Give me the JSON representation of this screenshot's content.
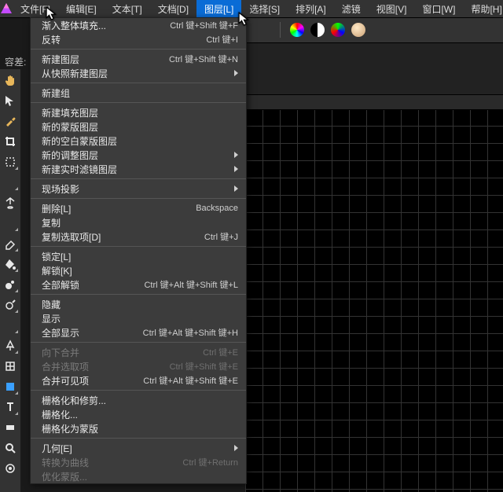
{
  "menubar": {
    "items": [
      {
        "label": "文件[F]"
      },
      {
        "label": "编辑[E]"
      },
      {
        "label": "文本[T]"
      },
      {
        "label": "文档[D]"
      },
      {
        "label": "图层[L]",
        "active": true
      },
      {
        "label": "选择[S]"
      },
      {
        "label": "排列[A]"
      },
      {
        "label": "滤镜"
      },
      {
        "label": "视图[V]"
      },
      {
        "label": "窗口[W]"
      },
      {
        "label": "帮助[H]"
      }
    ]
  },
  "left_label": "容差:",
  "dropdown": [
    {
      "type": "item",
      "label": "渐入整体填充...",
      "shortcut": "Ctrl 键+Shift 键+F"
    },
    {
      "type": "item",
      "label": "反转",
      "shortcut": "Ctrl 键+I"
    },
    {
      "type": "sep"
    },
    {
      "type": "item",
      "label": "新建图层",
      "shortcut": "Ctrl 键+Shift 键+N"
    },
    {
      "type": "item",
      "label": "从快照新建图层",
      "submenu": true
    },
    {
      "type": "sep"
    },
    {
      "type": "item",
      "label": "新建组"
    },
    {
      "type": "sep"
    },
    {
      "type": "item",
      "label": "新建填充图层"
    },
    {
      "type": "item",
      "label": "新的蒙版图层"
    },
    {
      "type": "item",
      "label": "新的空白蒙版图层"
    },
    {
      "type": "item",
      "label": "新的调整图层",
      "submenu": true
    },
    {
      "type": "item",
      "label": "新建实时滤镜图层",
      "submenu": true
    },
    {
      "type": "sep"
    },
    {
      "type": "item",
      "label": "现场投影",
      "submenu": true
    },
    {
      "type": "sep"
    },
    {
      "type": "item",
      "label": "删除[L]",
      "shortcut": "Backspace"
    },
    {
      "type": "item",
      "label": "复制"
    },
    {
      "type": "item",
      "label": "复制选取项[D]",
      "shortcut": "Ctrl 键+J"
    },
    {
      "type": "sep"
    },
    {
      "type": "item",
      "label": "锁定[L]"
    },
    {
      "type": "item",
      "label": "解锁[K]"
    },
    {
      "type": "item",
      "label": "全部解锁",
      "shortcut": "Ctrl 键+Alt 键+Shift 键+L"
    },
    {
      "type": "sep"
    },
    {
      "type": "item",
      "label": "隐藏"
    },
    {
      "type": "item",
      "label": "显示"
    },
    {
      "type": "item",
      "label": "全部显示",
      "shortcut": "Ctrl 键+Alt 键+Shift 键+H"
    },
    {
      "type": "sep"
    },
    {
      "type": "item",
      "label": "向下合并",
      "shortcut": "Ctrl 键+E",
      "disabled": true
    },
    {
      "type": "item",
      "label": "合并选取项",
      "shortcut": "Ctrl 键+Shift 键+E",
      "disabled": true
    },
    {
      "type": "item",
      "label": "合并可见项",
      "shortcut": "Ctrl 键+Alt 键+Shift 键+E"
    },
    {
      "type": "sep"
    },
    {
      "type": "item",
      "label": "栅格化和修剪..."
    },
    {
      "type": "item",
      "label": "栅格化..."
    },
    {
      "type": "item",
      "label": "栅格化为蒙版"
    },
    {
      "type": "sep"
    },
    {
      "type": "item",
      "label": "几何[E]",
      "submenu": true
    },
    {
      "type": "item",
      "label": "转换为曲线",
      "shortcut": "Ctrl 键+Return",
      "disabled": true
    },
    {
      "type": "item",
      "label": "优化蒙版...",
      "disabled": true
    }
  ],
  "tools": [
    {
      "name": "hand-tool",
      "color": "#e7b65a"
    },
    {
      "name": "move-tool",
      "color": "#e8e8e8"
    },
    {
      "name": "color-picker-tool",
      "color": "#e7b65a"
    },
    {
      "name": "crop-tool",
      "color": "#e8e8e8"
    },
    {
      "name": "marquee-tool",
      "color": "#e8e8e8",
      "tri": true
    },
    {
      "name": "lasso-tool",
      "color": "#e8e8e8",
      "tri": true
    },
    {
      "name": "flood-select-tool",
      "color": "#e8e8e8"
    },
    {
      "name": "paint-brush-tool",
      "color": "#3aa0ff",
      "tri": true
    },
    {
      "name": "erase-tool",
      "color": "#e8e8e8",
      "tri": true
    },
    {
      "name": "fill-tool",
      "color": "#e8e8e8",
      "tri": true
    },
    {
      "name": "clone-tool",
      "color": "#e8e8e8",
      "tri": true
    },
    {
      "name": "dodge-tool",
      "color": "#e8e8e8",
      "tri": true
    },
    {
      "name": "smudge-tool",
      "color": "#e8e8e8",
      "tri": true
    },
    {
      "name": "pen-tool",
      "color": "#e8e8e8",
      "tri": true
    },
    {
      "name": "mesh-tool",
      "color": "#e8e8e8"
    },
    {
      "name": "shape-tool",
      "color": "#3aa0ff",
      "tri": true
    },
    {
      "name": "text-tool",
      "color": "#e8e8e8",
      "tri": true
    },
    {
      "name": "gradient-tool",
      "color": "#e8e8e8"
    },
    {
      "name": "zoom-tool",
      "color": "#e8e8e8"
    },
    {
      "name": "view-tool",
      "color": "#e8e8e8"
    }
  ]
}
